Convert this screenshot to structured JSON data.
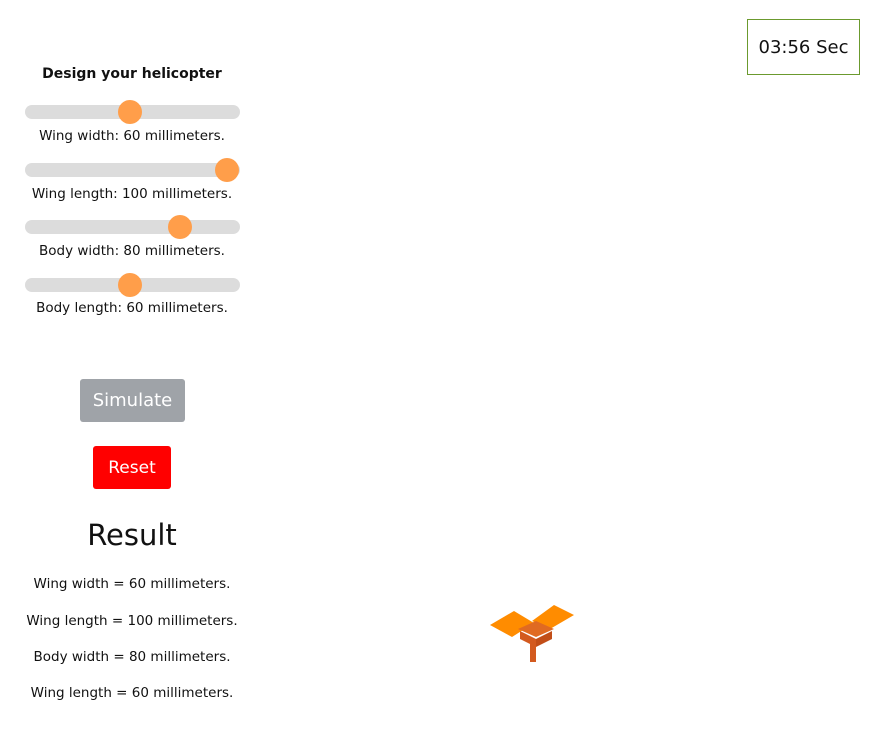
{
  "timer": {
    "text": "03:56 Sec"
  },
  "design": {
    "title": "Design your helicopter",
    "sliders": [
      {
        "label": "Wing width: 60 millimeters.",
        "fraction": 0.49
      },
      {
        "label": "Wing length: 100 millimeters.",
        "fraction": 0.94
      },
      {
        "label": "Body width: 80 millimeters.",
        "fraction": 0.72
      },
      {
        "label": "Body length: 60 millimeters.",
        "fraction": 0.49
      }
    ]
  },
  "buttons": {
    "simulate": "Simulate",
    "reset": "Reset"
  },
  "result": {
    "heading": "Result",
    "lines": [
      "Wing width = 60 millimeters.",
      "Wing length = 100 millimeters.",
      "Body width = 80 millimeters.",
      "Wing length = 60 millimeters."
    ]
  },
  "colors": {
    "thumb": "#ff9e4a",
    "track": "#dcdcdc",
    "simulate_bg": "#9fa3a8",
    "reset_bg": "#ff0000",
    "timer_border": "#6b9a2e",
    "heli_wing": "#ff8c00",
    "heli_body": "#d35a1f"
  }
}
